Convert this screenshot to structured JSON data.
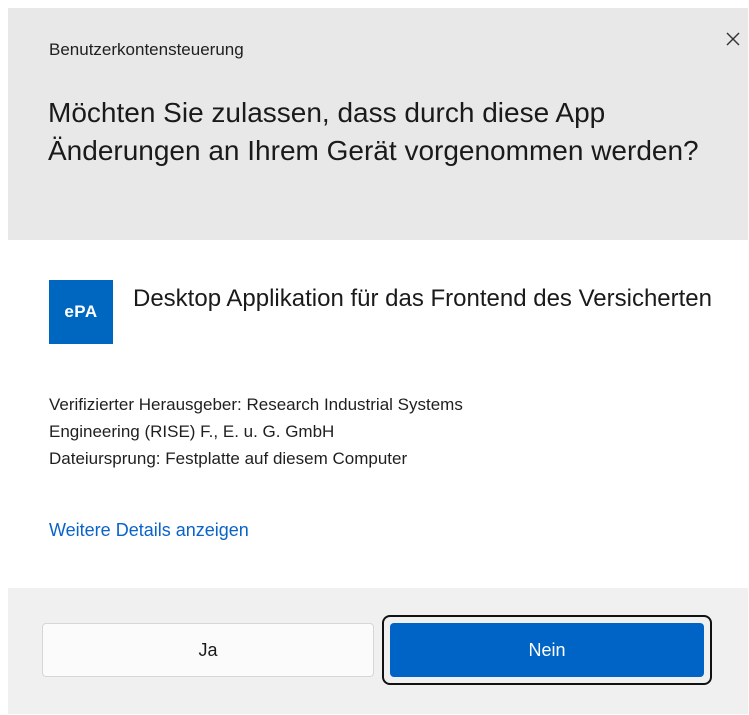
{
  "dialog": {
    "title": "Benutzerkontensteuerung",
    "question": "Möchten Sie zulassen, dass durch diese App Änderungen an Ihrem Gerät vorgenommen werden?"
  },
  "app": {
    "icon_text": "ePA",
    "icon_color": "#0067c0",
    "name": "Desktop Applikation für das Frontend des Versicherten"
  },
  "info": {
    "publisher_line1": "Verifizierter Herausgeber: Research Industrial Systems",
    "publisher_line2": "Engineering (RISE) F., E. u. G. GmbH",
    "origin": "Dateiursprung: Festplatte auf diesem Computer"
  },
  "details_link": "Weitere Details anzeigen",
  "buttons": {
    "yes": "Ja",
    "no": "Nein"
  },
  "colors": {
    "accent": "#0063c6",
    "link": "#0a63c9",
    "header_bg": "#e8e8e8",
    "footer_bg": "#f0f0f0"
  }
}
